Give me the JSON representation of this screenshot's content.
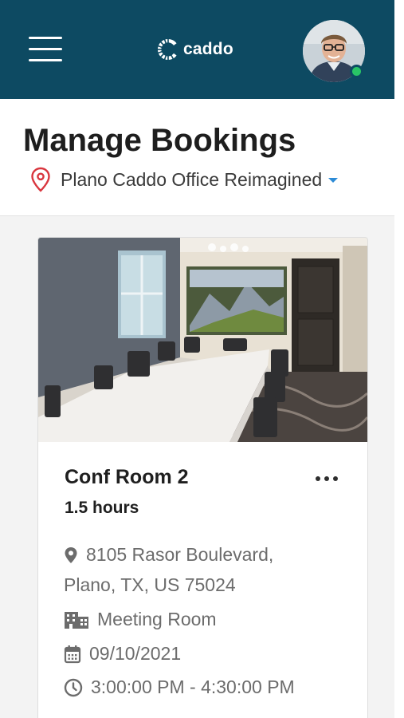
{
  "header": {
    "menu_icon": "hamburger-menu-icon",
    "logo_text": "caddo",
    "avatar_icon": "user-avatar",
    "status_color": "#29c466",
    "bar_color": "#0d4a62"
  },
  "page": {
    "title": "Manage Bookings",
    "location": "Plano Caddo Office Reimagined",
    "location_icon": "map-pin-icon",
    "accent": "#2d8bd6",
    "pin_color": "#d9363e"
  },
  "booking": {
    "room_name": "Conf Room 2",
    "duration": "1.5 hours",
    "address_line1": "8105 Rasor Boulevard,",
    "address_line2": "Plano, TX, US 75024",
    "room_type": "Meeting Room",
    "date": "09/10/2021",
    "time_range": "3:00:00 PM - 4:30:00 PM",
    "icons": [
      "location-icon",
      "building-icon",
      "calendar-icon",
      "clock-icon",
      "more-options-icon"
    ]
  }
}
